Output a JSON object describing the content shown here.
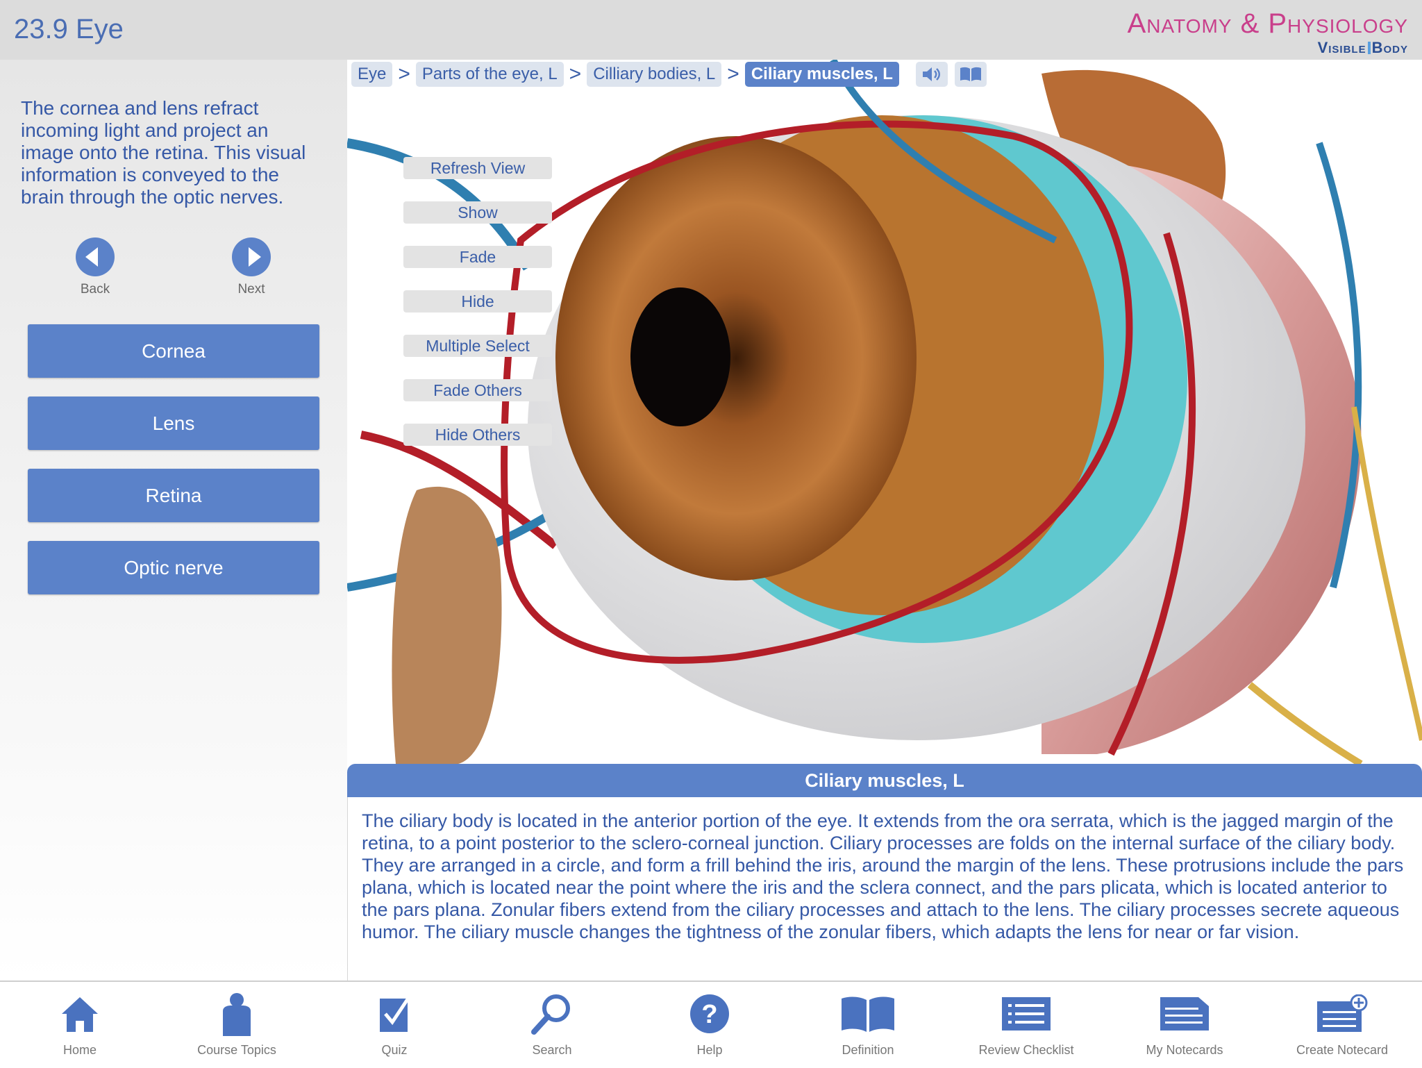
{
  "header": {
    "title": "23.9 Eye",
    "brand_top": "Anatomy & Physiology",
    "brand_bottom_a": "Visible",
    "brand_bottom_b": "Body"
  },
  "sidebar": {
    "intro": "The cornea and lens refract incoming light and project an image onto the retina. This visual information is conveyed to the brain through the optic nerves.",
    "back_label": "Back",
    "next_label": "Next",
    "topics": [
      "Cornea",
      "Lens",
      "Retina",
      "Optic nerve"
    ]
  },
  "breadcrumbs": {
    "items": [
      "Eye",
      "Parts of the eye, L",
      "Cilliary bodies, L",
      "Ciliary muscles, L"
    ],
    "separator": ">"
  },
  "tools": [
    "Refresh View",
    "Show",
    "Fade",
    "Hide",
    "Multiple Select",
    "Fade Others",
    "Hide Others"
  ],
  "detail": {
    "title": "Ciliary muscles, L",
    "text": "The ciliary body is located in the anterior portion of the eye. It extends from the ora serrata, which is the jagged margin of the retina, to a point posterior to the sclero-corneal junction. Ciliary processes are folds on the internal surface of the ciliary body. They are arranged in a circle, and form a frill behind the iris, around the margin of the lens. These protrusions include the pars plana, which is located near the point where the iris and the sclera connect, and the pars plicata, which is located anterior to the pars plana. Zonular fibers extend from the ciliary processes and attach to the lens. The ciliary processes secrete aqueous humor. The ciliary muscle changes the tightness of the zonular fibers, which adapts the lens for near or far vision."
  },
  "tabbar": {
    "items": [
      "Home",
      "Course Topics",
      "Quiz",
      "Search",
      "Help",
      "Definition",
      "Review Checklist",
      "My Notecards",
      "Create Notecard"
    ]
  },
  "colors": {
    "accent": "#5b82c9",
    "header_bg": "#dcdcdc",
    "brand_pink": "#c93f8b",
    "brand_blue": "#2a4d92"
  }
}
